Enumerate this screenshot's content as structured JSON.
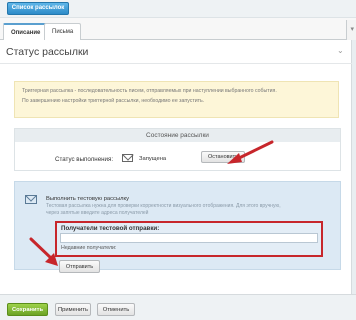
{
  "toolbar": {
    "list_button": "Список рассылок"
  },
  "tabs": [
    {
      "label": "Описание",
      "active": true
    },
    {
      "label": "Письма",
      "active": false
    }
  ],
  "section": {
    "title": "Статус рассылки"
  },
  "note": {
    "line1": "Триггерная рассылка - последовательность писем, отправляемых при наступлении выбранного события.",
    "line2": "По завершению настройки триггерной рассылки, необходимо ее запустить."
  },
  "state": {
    "header": "Состояние рассылки",
    "label": "Статус выполнения:",
    "value": "Запущена",
    "stop_button": "Остановить"
  },
  "test": {
    "title": "Выполнить тестовую рассылку",
    "description": "Тестовая рассылка нужна для проверки корректности визуального отображения. Для этого вручную, через запятые введите адреса получателей",
    "recipients_label": "Получатели тестовой отправки:",
    "recipients_value": "",
    "recent_label": "Недавние получатели:",
    "send_button": "Отправить"
  },
  "footer": {
    "save": "Сохранить",
    "apply": "Применить",
    "cancel": "Отменить"
  },
  "colors": {
    "accent_blue": "#2d8bc8",
    "save_green": "#6da325",
    "highlight_red": "#c7262b"
  }
}
